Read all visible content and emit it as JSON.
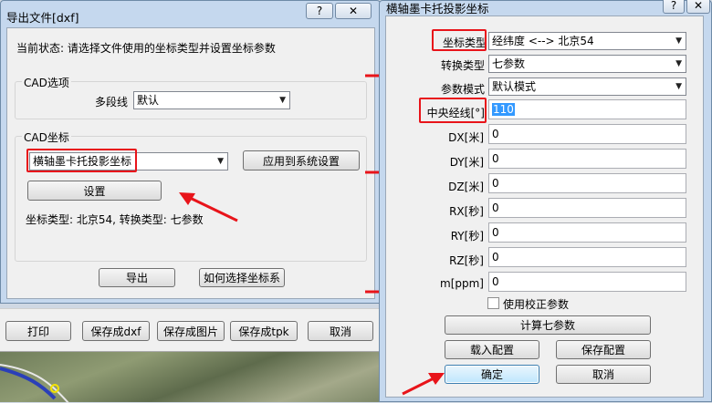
{
  "left_dialog": {
    "title": "导出文件[dxf]",
    "help_btn": "?",
    "close_btn": "✕",
    "status_text": "当前状态: 请选择文件使用的坐标类型并设置坐标参数",
    "cad_options": {
      "group_label": "CAD选项",
      "polyline_label": "多段线",
      "polyline_value": "默认"
    },
    "cad_coords": {
      "group_label": "CAD坐标",
      "coord_value": "横轴墨卡托投影坐标",
      "apply_btn": "应用到系统设置",
      "settings_btn": "设置",
      "info_text": "坐标类型: 北京54, 转换类型: 七参数"
    },
    "export_btn": "导出",
    "howto_btn": "如何选择坐标系"
  },
  "bottom_toolbar": {
    "print": "打印",
    "save_dxf": "保存成dxf",
    "save_image": "保存成图片",
    "save_tpk": "保存成tpk",
    "cancel": "取消"
  },
  "right_dialog": {
    "title": "横轴墨卡托投影坐标",
    "help_btn": "?",
    "close_btn": "✕",
    "coord_type_label": "坐标类型",
    "coord_type_value": "经纬度 <--> 北京54",
    "transform_type_label": "转换类型",
    "transform_type_value": "七参数",
    "param_mode_label": "参数模式",
    "param_mode_value": "默认模式",
    "central_meridian_label": "中央经线[°]",
    "central_meridian_value": "110",
    "params": [
      {
        "label": "DX[米]",
        "value": "0"
      },
      {
        "label": "DY[米]",
        "value": "0"
      },
      {
        "label": "DZ[米]",
        "value": "0"
      },
      {
        "label": "RX[秒]",
        "value": "0"
      },
      {
        "label": "RY[秒]",
        "value": "0"
      },
      {
        "label": "RZ[秒]",
        "value": "0"
      },
      {
        "label": "m[ppm]",
        "value": "0"
      }
    ],
    "use_correction_label": "使用校正参数",
    "calc_seven_btn": "计算七参数",
    "load_config_btn": "载入配置",
    "save_config_btn": "保存配置",
    "ok_btn": "确定",
    "cancel_btn": "取消"
  },
  "colors": {
    "annotation_red": "#e8141a",
    "window_frame": "#c5d8ee",
    "selection_blue": "#3399ff"
  }
}
